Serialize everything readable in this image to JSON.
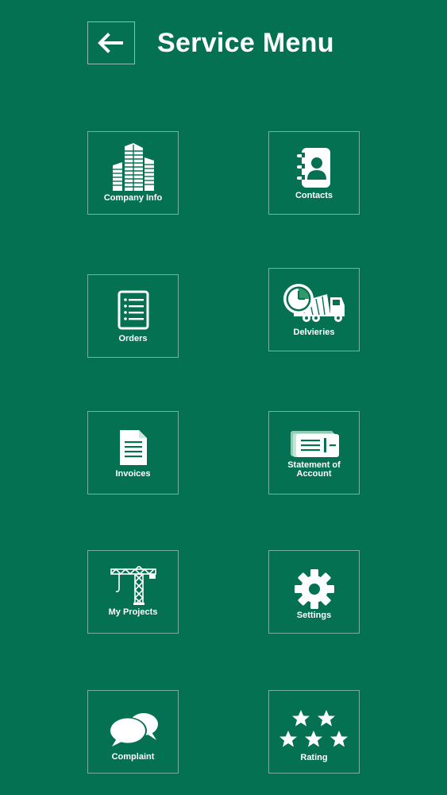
{
  "header": {
    "title": "Service Menu"
  },
  "menu": [
    {
      "id": "company-info",
      "label": "Company Info",
      "icon": "buildings-icon"
    },
    {
      "id": "contacts",
      "label": "Contacts",
      "icon": "contact-book-icon"
    },
    {
      "id": "orders",
      "label": "Orders",
      "icon": "checklist-icon"
    },
    {
      "id": "deliveries",
      "label": "Delvieries",
      "icon": "mixer-truck-icon"
    },
    {
      "id": "invoices",
      "label": "Invoices",
      "icon": "document-icon"
    },
    {
      "id": "statement",
      "label": "Statement of Account",
      "icon": "statement-cards-icon"
    },
    {
      "id": "my-projects",
      "label": "My Projects",
      "icon": "crane-icon"
    },
    {
      "id": "settings",
      "label": "Settings",
      "icon": "gear-icon"
    },
    {
      "id": "complaint",
      "label": "Complaint",
      "icon": "speech-bubbles-icon"
    },
    {
      "id": "rating",
      "label": "Rating",
      "icon": "stars-icon"
    }
  ],
  "colors": {
    "background": "#047152",
    "foreground": "#ffffff"
  }
}
